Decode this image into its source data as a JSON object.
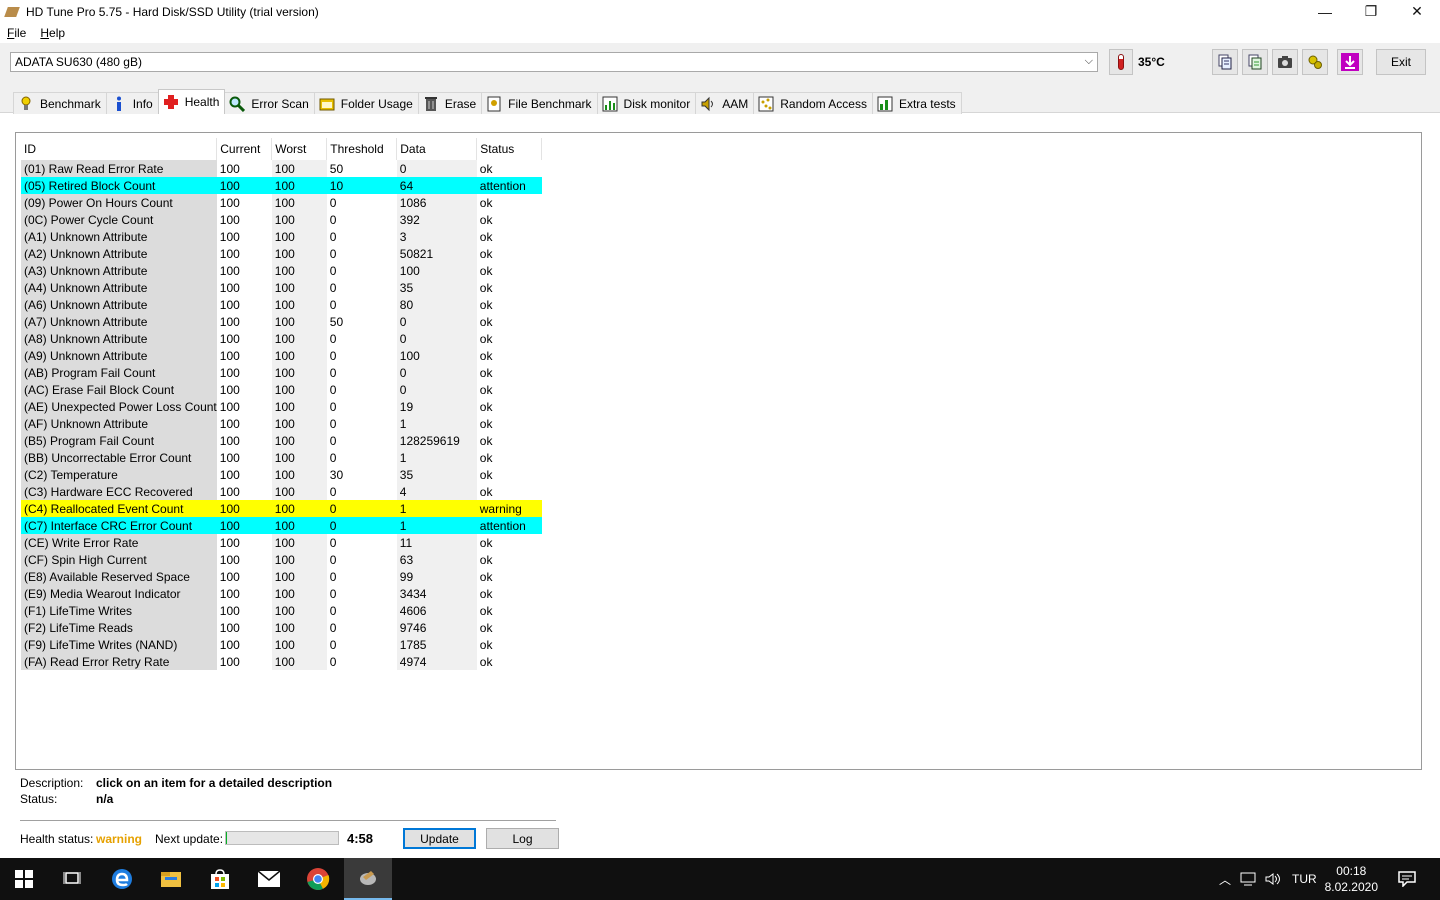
{
  "window": {
    "title": "HD Tune Pro 5.75 - Hard Disk/SSD Utility (trial version)",
    "minimize_glyph": "—",
    "restore_glyph": "❐",
    "close_glyph": "✕"
  },
  "menu": [
    "File",
    "Help"
  ],
  "drive": {
    "selected": "ADATA SU630 (480 gB)",
    "temperature": "35°C",
    "exit_label": "Exit"
  },
  "toolbar_icons": [
    "copy-text-icon",
    "copy-info-icon",
    "screenshot-icon",
    "options-icon",
    "save-icon"
  ],
  "tabs": [
    {
      "label": "Benchmark",
      "icon": "benchmark-icon"
    },
    {
      "label": "Info",
      "icon": "info-icon"
    },
    {
      "label": "Health",
      "icon": "health-icon",
      "active": true
    },
    {
      "label": "Error Scan",
      "icon": "error-scan-icon"
    },
    {
      "label": "Folder Usage",
      "icon": "folder-icon"
    },
    {
      "label": "Erase",
      "icon": "erase-icon"
    },
    {
      "label": "File Benchmark",
      "icon": "file-benchmark-icon"
    },
    {
      "label": "Disk monitor",
      "icon": "disk-monitor-icon"
    },
    {
      "label": "AAM",
      "icon": "speaker-icon"
    },
    {
      "label": "Random Access",
      "icon": "random-access-icon"
    },
    {
      "label": "Extra tests",
      "icon": "extra-tests-icon"
    }
  ],
  "table": {
    "headers": [
      "ID",
      "Current",
      "Worst",
      "Threshold",
      "Data",
      "Status"
    ],
    "rows": [
      [
        "(01) Raw Read Error Rate",
        "100",
        "100",
        "50",
        "0",
        "ok"
      ],
      [
        "(05) Retired Block Count",
        "100",
        "100",
        "10",
        "64",
        "attention"
      ],
      [
        "(09) Power On Hours Count",
        "100",
        "100",
        "0",
        "1086",
        "ok"
      ],
      [
        "(0C) Power Cycle Count",
        "100",
        "100",
        "0",
        "392",
        "ok"
      ],
      [
        "(A1) Unknown Attribute",
        "100",
        "100",
        "0",
        "3",
        "ok"
      ],
      [
        "(A2) Unknown Attribute",
        "100",
        "100",
        "0",
        "50821",
        "ok"
      ],
      [
        "(A3) Unknown Attribute",
        "100",
        "100",
        "0",
        "100",
        "ok"
      ],
      [
        "(A4) Unknown Attribute",
        "100",
        "100",
        "0",
        "35",
        "ok"
      ],
      [
        "(A6) Unknown Attribute",
        "100",
        "100",
        "0",
        "80",
        "ok"
      ],
      [
        "(A7) Unknown Attribute",
        "100",
        "100",
        "50",
        "0",
        "ok"
      ],
      [
        "(A8) Unknown Attribute",
        "100",
        "100",
        "0",
        "0",
        "ok"
      ],
      [
        "(A9) Unknown Attribute",
        "100",
        "100",
        "0",
        "100",
        "ok"
      ],
      [
        "(AB) Program Fail Count",
        "100",
        "100",
        "0",
        "0",
        "ok"
      ],
      [
        "(AC) Erase Fail Block Count",
        "100",
        "100",
        "0",
        "0",
        "ok"
      ],
      [
        "(AE) Unexpected Power Loss Count",
        "100",
        "100",
        "0",
        "19",
        "ok"
      ],
      [
        "(AF) Unknown Attribute",
        "100",
        "100",
        "0",
        "1",
        "ok"
      ],
      [
        "(B5) Program Fail Count",
        "100",
        "100",
        "0",
        "128259619",
        "ok"
      ],
      [
        "(BB) Uncorrectable Error Count",
        "100",
        "100",
        "0",
        "1",
        "ok"
      ],
      [
        "(C2) Temperature",
        "100",
        "100",
        "30",
        "35",
        "ok"
      ],
      [
        "(C3) Hardware ECC Recovered",
        "100",
        "100",
        "0",
        "4",
        "ok"
      ],
      [
        "(C4) Reallocated Event Count",
        "100",
        "100",
        "0",
        "1",
        "warning"
      ],
      [
        "(C7) Interface CRC Error Count",
        "100",
        "100",
        "0",
        "1",
        "attention"
      ],
      [
        "(CE) Write Error Rate",
        "100",
        "100",
        "0",
        "11",
        "ok"
      ],
      [
        "(CF) Spin High Current",
        "100",
        "100",
        "0",
        "63",
        "ok"
      ],
      [
        "(E8) Available Reserved Space",
        "100",
        "100",
        "0",
        "99",
        "ok"
      ],
      [
        "(E9) Media Wearout Indicator",
        "100",
        "100",
        "0",
        "3434",
        "ok"
      ],
      [
        "(F1) LifeTime Writes",
        "100",
        "100",
        "0",
        "4606",
        "ok"
      ],
      [
        "(F2) LifeTime Reads",
        "100",
        "100",
        "0",
        "9746",
        "ok"
      ],
      [
        "(F9) LifeTime Writes (NAND)",
        "100",
        "100",
        "0",
        "1785",
        "ok"
      ],
      [
        "(FA) Read Error Retry Rate",
        "100",
        "100",
        "0",
        "4974",
        "ok"
      ]
    ],
    "colors": {
      "attention": "#00ffff",
      "warning": "#ffff00"
    }
  },
  "description": {
    "desc_label": "Description:",
    "desc_value": "click on an item for a detailed description",
    "status_label": "Status:",
    "status_value": "n/a"
  },
  "footer": {
    "health_label": "Health status:",
    "health_value": "warning",
    "health_color": "#e6a100",
    "next_update_label": "Next update:",
    "next_update_progress": 0.01,
    "next_update_time": "4:58",
    "update_label": "Update",
    "log_label": "Log"
  },
  "taskbar": {
    "items": [
      "start-icon",
      "task-view-icon",
      "edge-icon",
      "file-explorer-icon",
      "store-icon",
      "mail-icon",
      "chrome-icon",
      "hdtune-icon"
    ],
    "language": "TUR",
    "time": "00:18",
    "date": "8.02.2020"
  }
}
